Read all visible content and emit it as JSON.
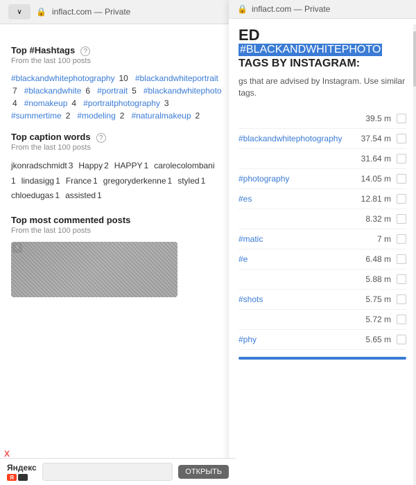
{
  "left_panel": {
    "browser_bar": {
      "lock": "🔒",
      "url": "inflact.com — Private",
      "chevron": "∨"
    },
    "hashtags_section": {
      "title": "Top #Hashtags",
      "help": "?",
      "subtitle": "From the last 100 posts",
      "hashtags": [
        {
          "tag": "#blackandwhitephotography",
          "count": "10"
        },
        {
          "tag": "#blackandwhiteportrait",
          "count": "7"
        },
        {
          "tag": "#blackandwhite",
          "count": "6"
        },
        {
          "tag": "#portrait",
          "count": "5"
        },
        {
          "tag": "#blackandwhitephoto",
          "count": "4"
        },
        {
          "tag": "#nomakeup",
          "count": "4"
        },
        {
          "tag": "#portraitphotography",
          "count": "3"
        },
        {
          "tag": "#summertime",
          "count": "2"
        },
        {
          "tag": "#modeling",
          "count": "2"
        },
        {
          "tag": "#naturalmakeup",
          "count": "2"
        }
      ]
    },
    "caption_section": {
      "title": "Top caption words",
      "help": "?",
      "subtitle": "From the last 100 posts",
      "words": [
        {
          "word": "jkonradschmidt",
          "count": "3"
        },
        {
          "word": "Happy",
          "count": "2"
        },
        {
          "word": "HAPPY",
          "count": "1"
        },
        {
          "word": "carolecolombani",
          "count": "1"
        },
        {
          "word": "lindasigg",
          "count": "1"
        },
        {
          "word": "France",
          "count": "1"
        },
        {
          "word": "gregoryderkenne",
          "count": "1"
        },
        {
          "word": "styled",
          "count": "1"
        },
        {
          "word": "chloedugas",
          "count": "1"
        },
        {
          "word": "assisted",
          "count": "1"
        }
      ]
    },
    "comments_section": {
      "title": "Top most commented posts",
      "subtitle": "From the last 100 posts"
    },
    "ad": {
      "close_x": "X",
      "brand": "яндекс",
      "brand_name": "Яндекс",
      "input_placeholder": "",
      "open_button": "ОТКРЫТЬ",
      "bottom_x": "X"
    }
  },
  "right_panel": {
    "browser_bar": {
      "lock": "🔒",
      "url": "inflact.com — Private"
    },
    "title_line1": "ED",
    "title_highlight": "#BLACKANDWHITEPHOTO",
    "title_line3": "TAGS BY INSTAGRAM:",
    "description": "gs that are advised by Instagram. Use similar tags.",
    "tags": [
      {
        "name": "",
        "count": "39.5 m"
      },
      {
        "name": "#blackandwhitephotography",
        "count": "37.54 m"
      },
      {
        "name": "",
        "count": "31.64 m"
      },
      {
        "name": "#photography",
        "count": "14.05 m"
      },
      {
        "name": "#es",
        "count": "12.81 m"
      },
      {
        "name": "",
        "count": "8.32 m"
      },
      {
        "name": "#matic",
        "count": "7 m"
      },
      {
        "name": "#e",
        "count": "6.48 m"
      },
      {
        "name": "",
        "count": "5.88 m"
      },
      {
        "name": "#shots",
        "count": "5.75 m"
      },
      {
        "name": "",
        "count": "5.72 m"
      },
      {
        "name": "#phy",
        "count": "5.65 m"
      }
    ]
  }
}
